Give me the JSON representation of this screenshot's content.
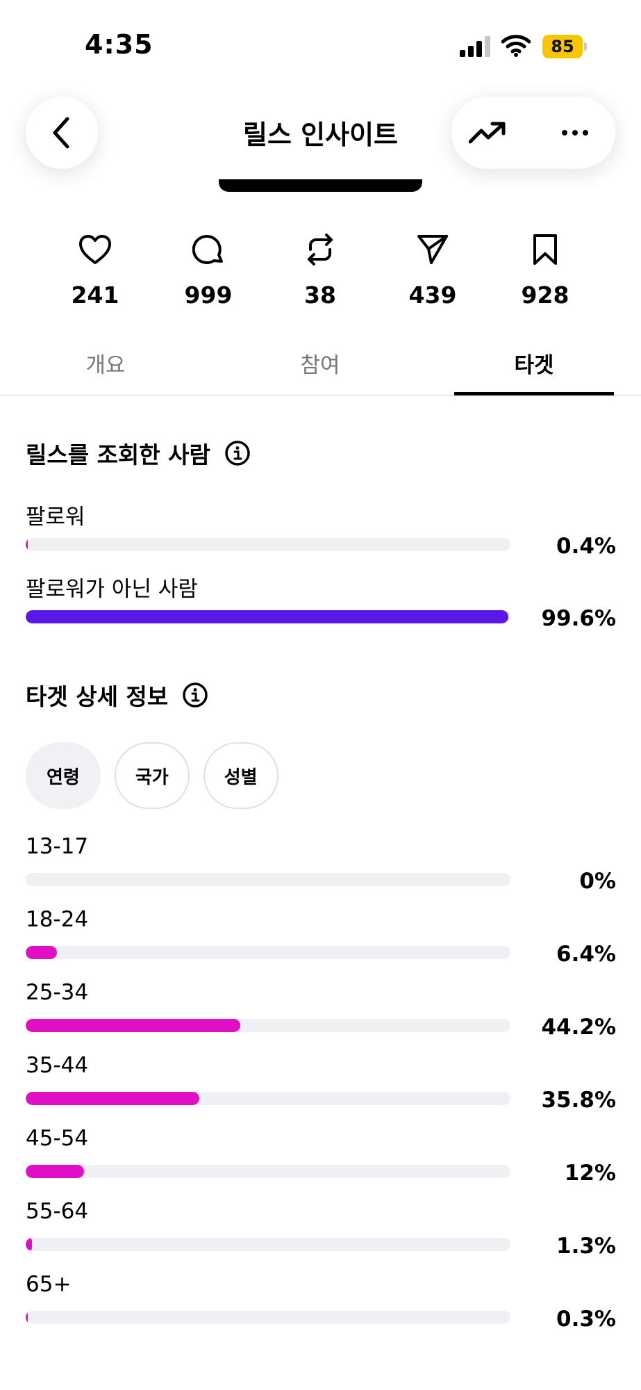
{
  "status_bar": {
    "time": "4:35",
    "battery": "85"
  },
  "header": {
    "title": "릴스 인사이트"
  },
  "icons": {
    "back": "chevron-left-icon",
    "trend": "trending-up-icon",
    "more": "more-horizontal-icon",
    "info": "info-icon"
  },
  "stats": [
    {
      "icon": "heart-icon",
      "value": "241"
    },
    {
      "icon": "comment-icon",
      "value": "999"
    },
    {
      "icon": "repost-icon",
      "value": "38"
    },
    {
      "icon": "send-icon",
      "value": "439"
    },
    {
      "icon": "bookmark-icon",
      "value": "928"
    }
  ],
  "tabs": [
    {
      "label": "개요"
    },
    {
      "label": "참여"
    },
    {
      "label": "타겟"
    }
  ],
  "viewers": {
    "title": "릴스를 조회한 사람",
    "rows": [
      {
        "label": "팔로워",
        "value": "0.4%",
        "fraction": 0.004,
        "color": "#e20ec6"
      },
      {
        "label": "팔로워가 아닌 사람",
        "value": "99.6%",
        "fraction": 0.996,
        "color": "#5b16e8"
      }
    ]
  },
  "audience": {
    "title": "타겟 상세 정보",
    "chips": [
      {
        "label": "연령"
      },
      {
        "label": "국가"
      },
      {
        "label": "성별"
      }
    ],
    "color": "#e20ec6",
    "rows": [
      {
        "label": "13-17",
        "value": "0%",
        "fraction": 0.0
      },
      {
        "label": "18-24",
        "value": "6.4%",
        "fraction": 0.064
      },
      {
        "label": "25-34",
        "value": "44.2%",
        "fraction": 0.442
      },
      {
        "label": "35-44",
        "value": "35.8%",
        "fraction": 0.358
      },
      {
        "label": "45-54",
        "value": "12%",
        "fraction": 0.12
      },
      {
        "label": "55-64",
        "value": "1.3%",
        "fraction": 0.013
      },
      {
        "label": "65+",
        "value": "0.3%",
        "fraction": 0.003
      }
    ]
  }
}
